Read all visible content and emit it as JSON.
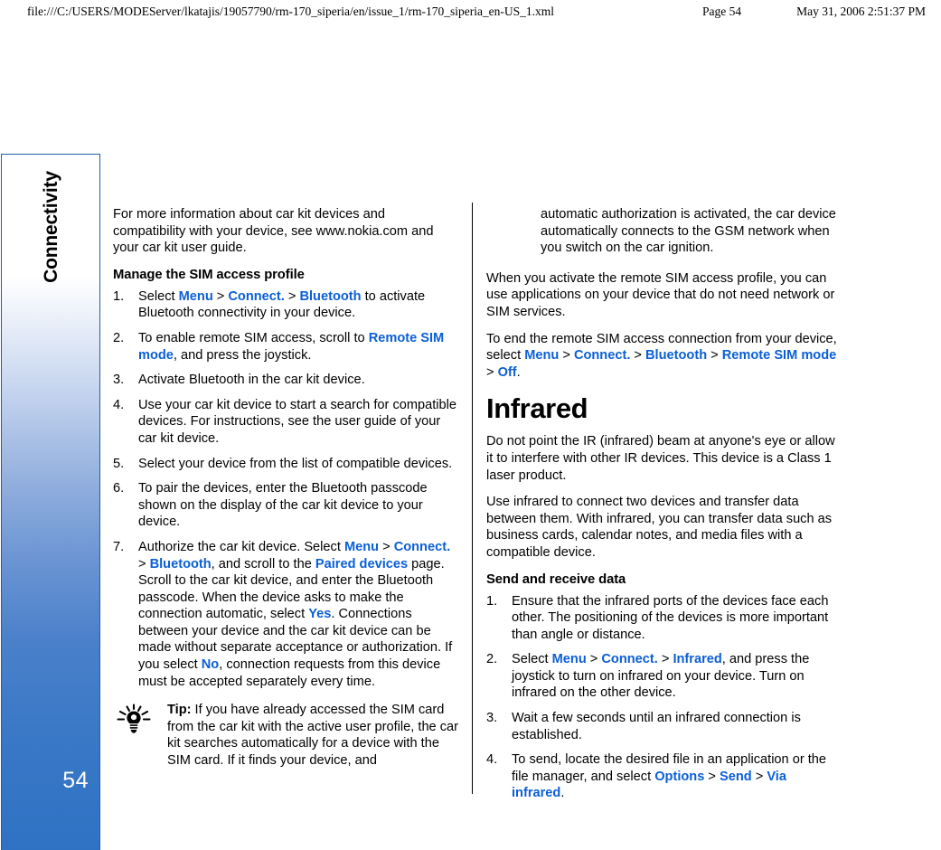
{
  "print_header": {
    "url": "file:///C:/USERS/MODEServer/lkatajis/19057790/rm-170_siperia/en/issue_1/rm-170_siperia_en-US_1.xml",
    "page": "Page 54",
    "date": "May 31, 2006 2:51:37 PM"
  },
  "sidebar": {
    "chapter": "Connectivity",
    "page_number": "54",
    "accent_color": "#2f72c4",
    "border_color": "#1f5fab"
  },
  "colors": {
    "ui_link": "#0b5fd6",
    "text": "#000000",
    "background": "#ffffff"
  },
  "left_column": {
    "intro": "For more information about car kit devices and compatibility with your device, see www.nokia.com and your car kit user guide.",
    "heading": "Manage the SIM access profile",
    "steps": [
      {
        "parts": [
          {
            "t": "Select ",
            "k": "plain"
          },
          {
            "t": "Menu",
            "k": "ui"
          },
          {
            "t": " > ",
            "k": "sep"
          },
          {
            "t": "Connect.",
            "k": "ui"
          },
          {
            "t": " > ",
            "k": "sep"
          },
          {
            "t": "Bluetooth",
            "k": "ui"
          },
          {
            "t": " to activate Bluetooth connectivity in your device.",
            "k": "plain"
          }
        ]
      },
      {
        "parts": [
          {
            "t": "To enable remote SIM access, scroll to ",
            "k": "plain"
          },
          {
            "t": "Remote SIM mode",
            "k": "ui"
          },
          {
            "t": ", and press the joystick.",
            "k": "plain"
          }
        ]
      },
      {
        "parts": [
          {
            "t": "Activate Bluetooth in the car kit device.",
            "k": "plain"
          }
        ]
      },
      {
        "parts": [
          {
            "t": "Use your car kit device to start a search for compatible devices. For instructions, see the user guide of your car kit device.",
            "k": "plain"
          }
        ]
      },
      {
        "parts": [
          {
            "t": "Select your device from the list of compatible devices.",
            "k": "plain"
          }
        ]
      },
      {
        "parts": [
          {
            "t": "To pair the devices, enter the Bluetooth passcode shown on the display of the car kit device to your device.",
            "k": "plain"
          }
        ]
      },
      {
        "parts": [
          {
            "t": "Authorize the car kit device. Select ",
            "k": "plain"
          },
          {
            "t": "Menu",
            "k": "ui"
          },
          {
            "t": " > ",
            "k": "sep"
          },
          {
            "t": "Connect.",
            "k": "ui"
          },
          {
            "t": " > ",
            "k": "sep"
          },
          {
            "t": "Bluetooth",
            "k": "ui"
          },
          {
            "t": ", and scroll to the ",
            "k": "plain"
          },
          {
            "t": "Paired devices",
            "k": "ui"
          },
          {
            "t": " page. Scroll to the car kit device, and enter the Bluetooth passcode. When the device asks to make the connection automatic, select ",
            "k": "plain"
          },
          {
            "t": "Yes",
            "k": "ui"
          },
          {
            "t": ". Connections between your device and the car kit device can be made without separate acceptance or authorization. If you select ",
            "k": "plain"
          },
          {
            "t": "No",
            "k": "ui"
          },
          {
            "t": ", connection requests from this device must be accepted separately every time.",
            "k": "plain"
          }
        ]
      }
    ],
    "tip": {
      "icon": "lightbulb-icon",
      "label": "Tip:",
      "text": " If you have already accessed the SIM card from the car kit with the active user profile, the car kit searches automatically for a device with the SIM card. If it finds your device, and"
    }
  },
  "right_column": {
    "tip_continuation": "automatic authorization is activated, the car device automatically connects to the GSM network when you switch on the car ignition.",
    "para_activate": "When you activate the remote SIM access profile, you can use applications on your device that do not need network or SIM services.",
    "para_end": {
      "parts": [
        {
          "t": "To end the remote SIM access connection from your device, select ",
          "k": "plain"
        },
        {
          "t": "Menu",
          "k": "ui"
        },
        {
          "t": " > ",
          "k": "sep"
        },
        {
          "t": "Connect.",
          "k": "ui"
        },
        {
          "t": " > ",
          "k": "sep"
        },
        {
          "t": "Bluetooth",
          "k": "ui"
        },
        {
          "t": " > ",
          "k": "sep"
        },
        {
          "t": "Remote SIM mode",
          "k": "ui"
        },
        {
          "t": " > ",
          "k": "sep"
        },
        {
          "t": "Off",
          "k": "ui"
        },
        {
          "t": ".",
          "k": "plain"
        }
      ]
    },
    "chapter_heading": "Infrared",
    "para_warning": "Do not point the IR (infrared) beam at anyone's eye or allow it to interfere with other IR devices. This device is a Class 1 laser product.",
    "para_use": "Use infrared to connect two devices and transfer data between them. With infrared, you can transfer data such as business cards, calendar notes, and media files with a compatible device.",
    "heading": "Send and receive data",
    "steps": [
      {
        "parts": [
          {
            "t": "Ensure that the infrared ports of the devices face each other. The positioning of the devices is more important than angle or distance.",
            "k": "plain"
          }
        ]
      },
      {
        "parts": [
          {
            "t": "Select ",
            "k": "plain"
          },
          {
            "t": "Menu",
            "k": "ui"
          },
          {
            "t": " > ",
            "k": "sep"
          },
          {
            "t": "Connect.",
            "k": "ui"
          },
          {
            "t": " > ",
            "k": "sep"
          },
          {
            "t": "Infrared",
            "k": "ui"
          },
          {
            "t": ", and press the joystick to turn on infrared on your device. Turn on infrared on the other device.",
            "k": "plain"
          }
        ]
      },
      {
        "parts": [
          {
            "t": "Wait a few seconds until an infrared connection is established.",
            "k": "plain"
          }
        ]
      },
      {
        "parts": [
          {
            "t": "To send, locate the desired file in an application or the file manager, and select ",
            "k": "plain"
          },
          {
            "t": "Options",
            "k": "ui"
          },
          {
            "t": " > ",
            "k": "sep"
          },
          {
            "t": "Send",
            "k": "ui"
          },
          {
            "t": " > ",
            "k": "sep"
          },
          {
            "t": "Via infrared",
            "k": "ui"
          },
          {
            "t": ".",
            "k": "plain"
          }
        ]
      }
    ]
  }
}
